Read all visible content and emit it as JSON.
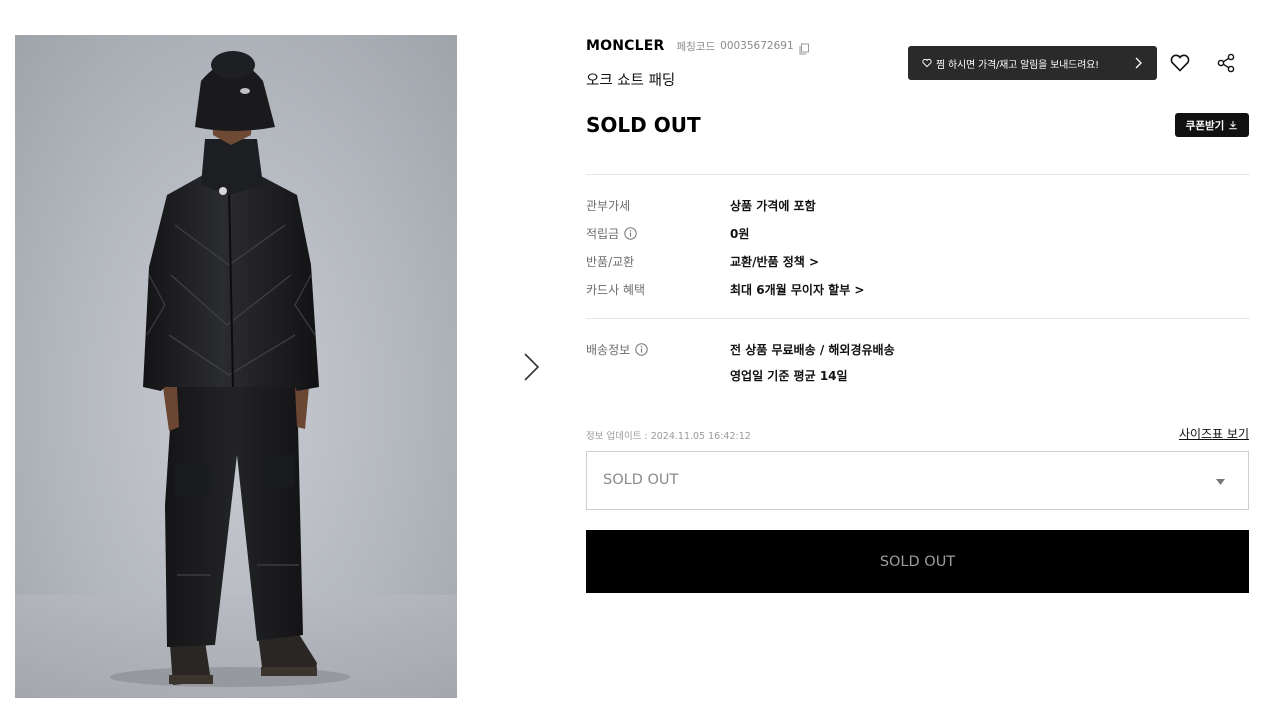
{
  "product": {
    "brand": "MONCLER",
    "code_label": "페칭코드",
    "code_value": "00035672691",
    "name": "오크 쇼트 패딩",
    "status": "SOLD OUT"
  },
  "wishlist_tip": {
    "text": "찜 하시면 가격/재고 알림을 보내드려요!"
  },
  "icons": {
    "copy": "copy-icon",
    "heart": "heart-icon",
    "share": "share-icon",
    "download": "download-icon",
    "info": "info-icon",
    "next": "chevron-right-icon",
    "caret": "caret-down-icon"
  },
  "coupon": {
    "label": "쿠폰받기"
  },
  "details": [
    {
      "label": "관부가세",
      "value": "상품 가격에 포함"
    },
    {
      "label": "적립금",
      "value": "0원"
    },
    {
      "label": "반품/교환",
      "value": "교환/반품 정책 >"
    },
    {
      "label": "카드사 혜택",
      "value": "최대 6개월 무이자 할부 >"
    }
  ],
  "shipping": {
    "label": "배송정보",
    "line1": "전 상품 무료배송 / 해외경유배송",
    "line2": "영업일 기준 평균 14일"
  },
  "update_info": "정보 업데이트 : 2024.11.05 16:42:12",
  "size_chart_link": "사이즈표 보기",
  "option_select": {
    "selected": "SOLD OUT"
  },
  "cta": {
    "label": "SOLD OUT"
  },
  "colors": {
    "black": "#000000",
    "tooltip_bg": "#2a2a2a",
    "muted_text": "#8a8a8a",
    "divider": "#e7e7e7"
  }
}
